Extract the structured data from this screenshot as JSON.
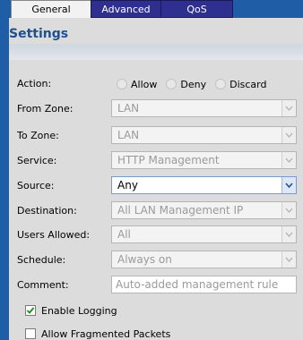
{
  "tabs": [
    {
      "label": "General",
      "active": true
    },
    {
      "label": "Advanced",
      "active": false
    },
    {
      "label": "QoS",
      "active": false
    }
  ],
  "section_title": "Settings",
  "action": {
    "label": "Action:",
    "options": [
      "Allow",
      "Deny",
      "Discard"
    ],
    "selected": "Allow",
    "enabled": false
  },
  "from_zone": {
    "label": "From Zone:",
    "value": "LAN",
    "enabled": false
  },
  "to_zone": {
    "label": "To Zone:",
    "value": "LAN",
    "enabled": false
  },
  "service": {
    "label": "Service:",
    "value": "HTTP Management",
    "enabled": false
  },
  "source": {
    "label": "Source:",
    "value": "Any",
    "enabled": true
  },
  "destination": {
    "label": "Destination:",
    "value": "All LAN Management IP",
    "enabled": false
  },
  "users_allowed": {
    "label": "Users Allowed:",
    "value": "All",
    "enabled": false
  },
  "schedule": {
    "label": "Schedule:",
    "value": "Always on",
    "enabled": false
  },
  "comment": {
    "label": "Comment:",
    "value": "Auto-added management rule"
  },
  "enable_logging": {
    "label": "Enable Logging",
    "checked": true
  },
  "allow_fragmented": {
    "label": "Allow Fragmented Packets",
    "checked": false
  },
  "colors": {
    "tab_bar": "#1f5ea7",
    "panel": "#dcdcdc",
    "title": "#1f4f8f"
  },
  "icons": {
    "dropdown": "chevron-down-icon",
    "check": "checkmark-icon"
  }
}
